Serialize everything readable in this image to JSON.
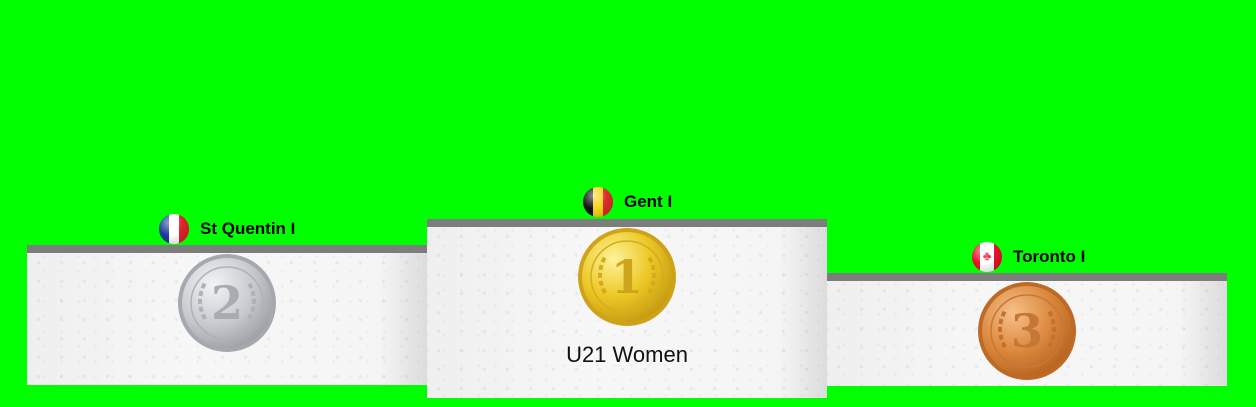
{
  "podium": {
    "event": "U21 Women",
    "first": {
      "place": "1",
      "team": "Gent I",
      "flag_icon": "belgium-flag-icon",
      "medal": "gold"
    },
    "second": {
      "place": "2",
      "team": "St Quentin I",
      "flag_icon": "france-flag-icon",
      "medal": "silver"
    },
    "third": {
      "place": "3",
      "team": "Toronto I",
      "flag_icon": "canada-flag-icon",
      "medal": "bronze"
    }
  },
  "colors": {
    "background": "#00ff00",
    "gold": "#e8c21e",
    "silver": "#c5c8cc",
    "bronze": "#d9843a"
  }
}
